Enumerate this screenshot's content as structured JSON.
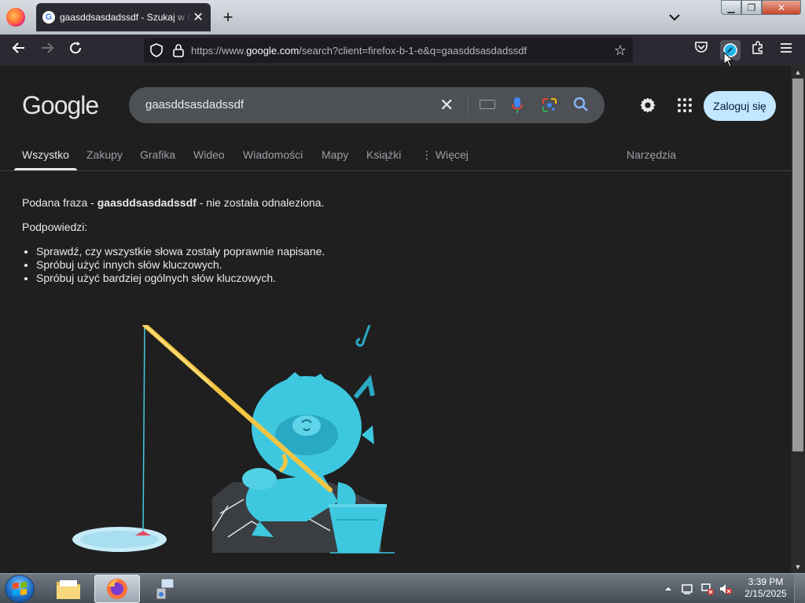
{
  "browser": {
    "tab_title": "gaasddsasdadssdf - Szukaj w Google",
    "url_prefix": "https://www.",
    "url_domain": "google.com",
    "url_rest": "/search?client=firefox-b-1-e&q=gaasddsasdadssdf"
  },
  "google": {
    "logo": "Google",
    "query": "gaasddsasdadssdf",
    "signin_label": "Zaloguj się",
    "tabs": [
      {
        "label": "Wszystko"
      },
      {
        "label": "Zakupy"
      },
      {
        "label": "Grafika"
      },
      {
        "label": "Wideo"
      },
      {
        "label": "Wiadomości"
      },
      {
        "label": "Mapy"
      },
      {
        "label": "Książki"
      },
      {
        "label": "⋮ Więcej"
      },
      {
        "label": "Narzędzia"
      }
    ],
    "no_results": {
      "prefix": "Podana fraza - ",
      "term": "gaasddsasdadssdf",
      "suffix": " - nie została odnaleziona.",
      "hints_title": "Podpowiedzi:",
      "hints": [
        "Sprawdź, czy wszystkie słowa zostały poprawnie napisane.",
        "Spróbuj użyć innych słów kluczowych.",
        "Spróbuj użyć bardziej ogólnych słów kluczowych."
      ]
    }
  },
  "taskbar": {
    "time": "3:39 PM",
    "date": "2/15/2025"
  }
}
